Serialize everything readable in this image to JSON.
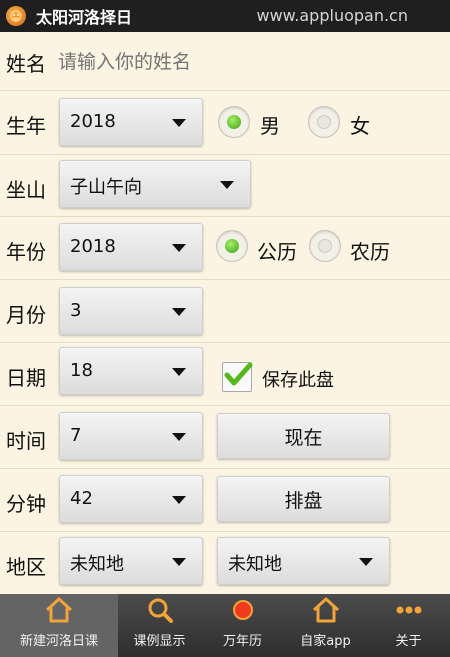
{
  "titlebar": {
    "app_title": "太阳河洛择日",
    "watermark": "www.appluopan.cn"
  },
  "name": {
    "label": "姓名",
    "placeholder": "请输入你的姓名"
  },
  "birth_year": {
    "label": "生年",
    "value": "2018"
  },
  "gender": {
    "male": "男",
    "female": "女",
    "selected": "男"
  },
  "sitting": {
    "label": "坐山",
    "value": "子山午向"
  },
  "year": {
    "label": "年份",
    "value": "2018"
  },
  "calendar": {
    "solar": "公历",
    "lunar": "农历",
    "selected": "公历"
  },
  "month": {
    "label": "月份",
    "value": "3"
  },
  "day": {
    "label": "日期",
    "value": "18"
  },
  "save": {
    "label": "保存此盘",
    "checked": true
  },
  "hour": {
    "label": "时间",
    "value": "7"
  },
  "now_button": "现在",
  "minute": {
    "label": "分钟",
    "value": "42"
  },
  "arrange_button": "排盘",
  "region": {
    "label": "地区",
    "value1": "未知地",
    "value2": "未知地"
  },
  "tabs": [
    {
      "label": "新建河洛日课",
      "icon": "home-icon",
      "active": true
    },
    {
      "label": "课例显示",
      "icon": "search-icon",
      "active": false
    },
    {
      "label": "万年历",
      "icon": "red-dot-icon",
      "active": false
    },
    {
      "label": "自家app",
      "icon": "home-icon",
      "active": false
    },
    {
      "label": "关于",
      "icon": "more-icon",
      "active": false
    }
  ],
  "colors": {
    "accent_green": "#3aa010",
    "tab_icon_orange": "#f2a33a",
    "background": "#fbf4e2"
  }
}
